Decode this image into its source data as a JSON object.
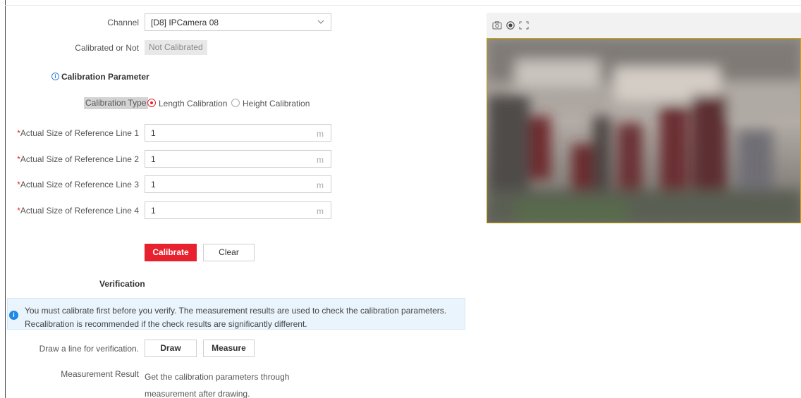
{
  "channel": {
    "label": "Channel",
    "value": "[D8] IPCamera 08"
  },
  "calibrated": {
    "label": "Calibrated or Not",
    "value": "Not Calibrated"
  },
  "calibration_parameter": {
    "title": "Calibration Parameter"
  },
  "calibration_type": {
    "label": "Calibration Type",
    "options": [
      "Length Calibration",
      "Height Calibration"
    ],
    "selected": "Length Calibration"
  },
  "reference_lines": [
    {
      "label": "Actual Size of Reference Line 1",
      "value": "1",
      "unit": "m"
    },
    {
      "label": "Actual Size of Reference Line 2",
      "value": "1",
      "unit": "m"
    },
    {
      "label": "Actual Size of Reference Line 3",
      "value": "1",
      "unit": "m"
    },
    {
      "label": "Actual Size of Reference Line 4",
      "value": "1",
      "unit": "m"
    }
  ],
  "required_mark": "*",
  "buttons": {
    "calibrate": "Calibrate",
    "clear": "Clear",
    "draw": "Draw",
    "measure": "Measure"
  },
  "verification": {
    "title": "Verification",
    "notice": "You must calibrate first before you verify. The measurement results are used to check the calibration parameters. Recalibration is recommended if the check results are significantly different.",
    "draw_label": "Draw a line for verification.",
    "result_label": "Measurement Result",
    "result_text": "Get the calibration parameters through measurement after drawing."
  },
  "preview": {
    "icons": [
      "camera-icon",
      "record-icon",
      "fullscreen-icon"
    ]
  },
  "colors": {
    "accent": "#e8212e",
    "info": "#1e88e5",
    "preview_border": "#c9a600"
  }
}
